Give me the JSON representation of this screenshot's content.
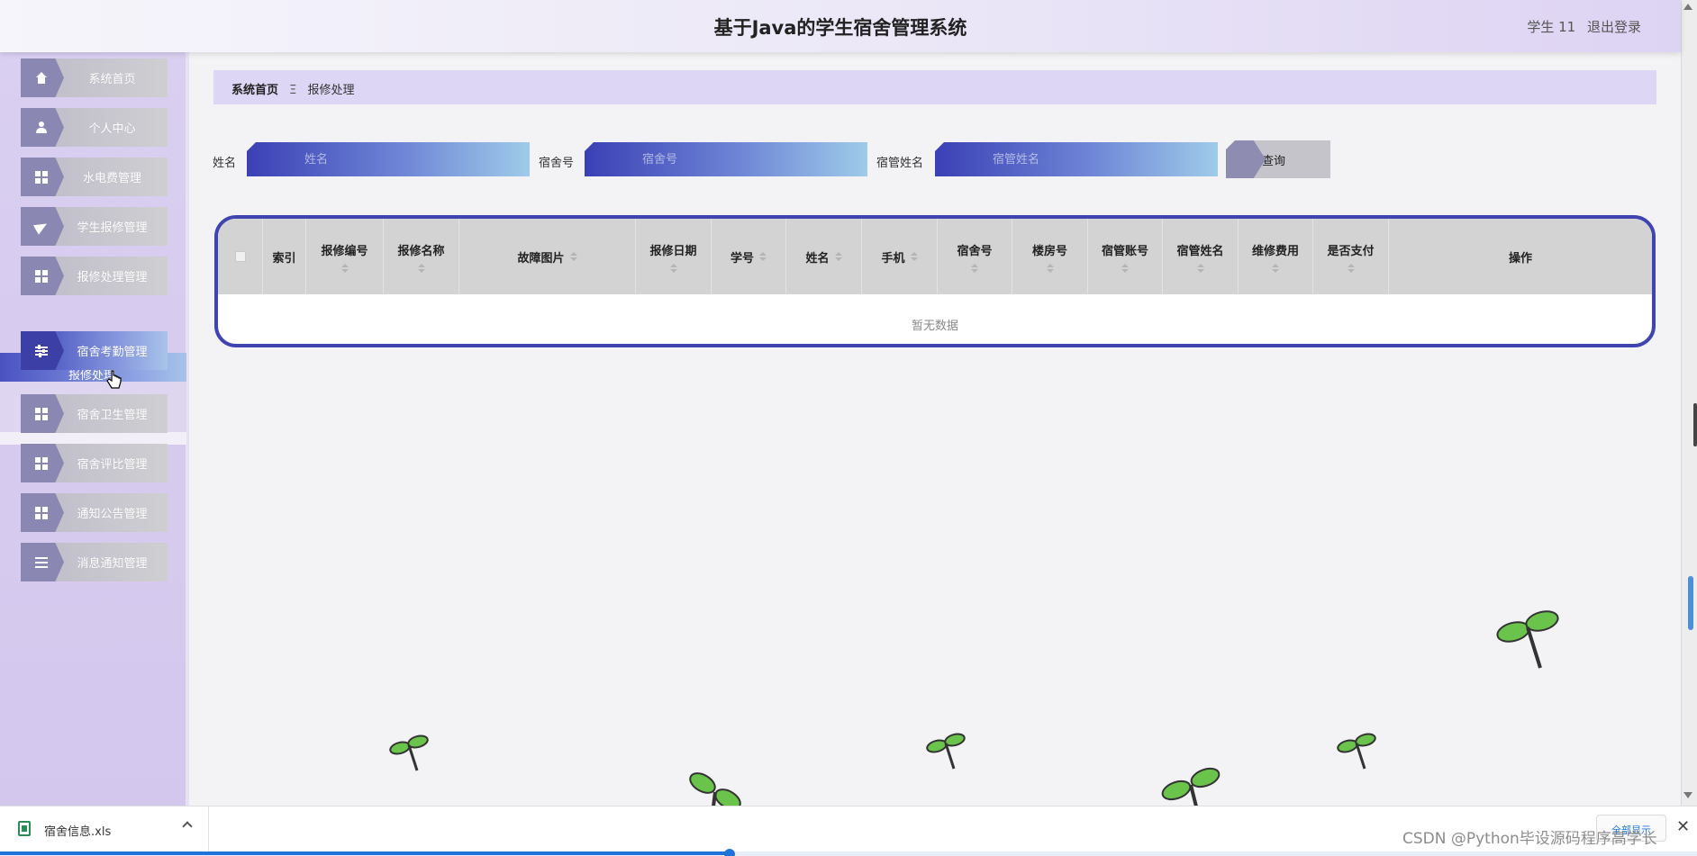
{
  "header": {
    "title": "基于Java的学生宿舍管理系统",
    "user": "学生 11",
    "logout": "退出登录"
  },
  "sidebar": {
    "items": [
      {
        "label": "系统首页",
        "icon": "home-icon"
      },
      {
        "label": "个人中心",
        "icon": "user-icon"
      },
      {
        "label": "水电费管理",
        "icon": "grid-icon"
      },
      {
        "label": "学生报修管理",
        "icon": "paper-plane-icon"
      },
      {
        "label": "报修处理管理",
        "icon": "grid-icon"
      },
      {
        "label": "宿舍考勤管理",
        "icon": "sliders-icon"
      },
      {
        "label": "宿舍卫生管理",
        "icon": "grid-icon"
      },
      {
        "label": "宿舍评比管理",
        "icon": "grid-icon"
      },
      {
        "label": "通知公告管理",
        "icon": "grid-icon"
      },
      {
        "label": "消息通知管理",
        "icon": "list-icon"
      }
    ],
    "expanded_sub": "报修处理"
  },
  "breadcrumb": {
    "home": "系统首页",
    "sep": "Ξ",
    "current": "报修处理"
  },
  "search": {
    "name_label": "姓名",
    "name_placeholder": "姓名",
    "dorm_label": "宿舍号",
    "dorm_placeholder": "宿舍号",
    "manager_label": "宿管姓名",
    "manager_placeholder": "宿管姓名",
    "button": "查询"
  },
  "table": {
    "columns": [
      "索引",
      "报修编号",
      "报修名称",
      "故障图片",
      "报修日期",
      "学号",
      "姓名",
      "手机",
      "宿舍号",
      "楼房号",
      "宿管账号",
      "宿管姓名",
      "维修费用",
      "是否支付",
      "操作"
    ],
    "empty_text": "暂无数据"
  },
  "downloads": {
    "file_name": "宿舍信息.xls",
    "show_all": "全部显示",
    "progress": 0.43
  },
  "watermark": "CSDN @Python毕设源码程序高学长",
  "colors": {
    "accent": "#3f44b1",
    "sidebar_bg": "#d9cff0",
    "propeller_green": "#6ac34a"
  }
}
